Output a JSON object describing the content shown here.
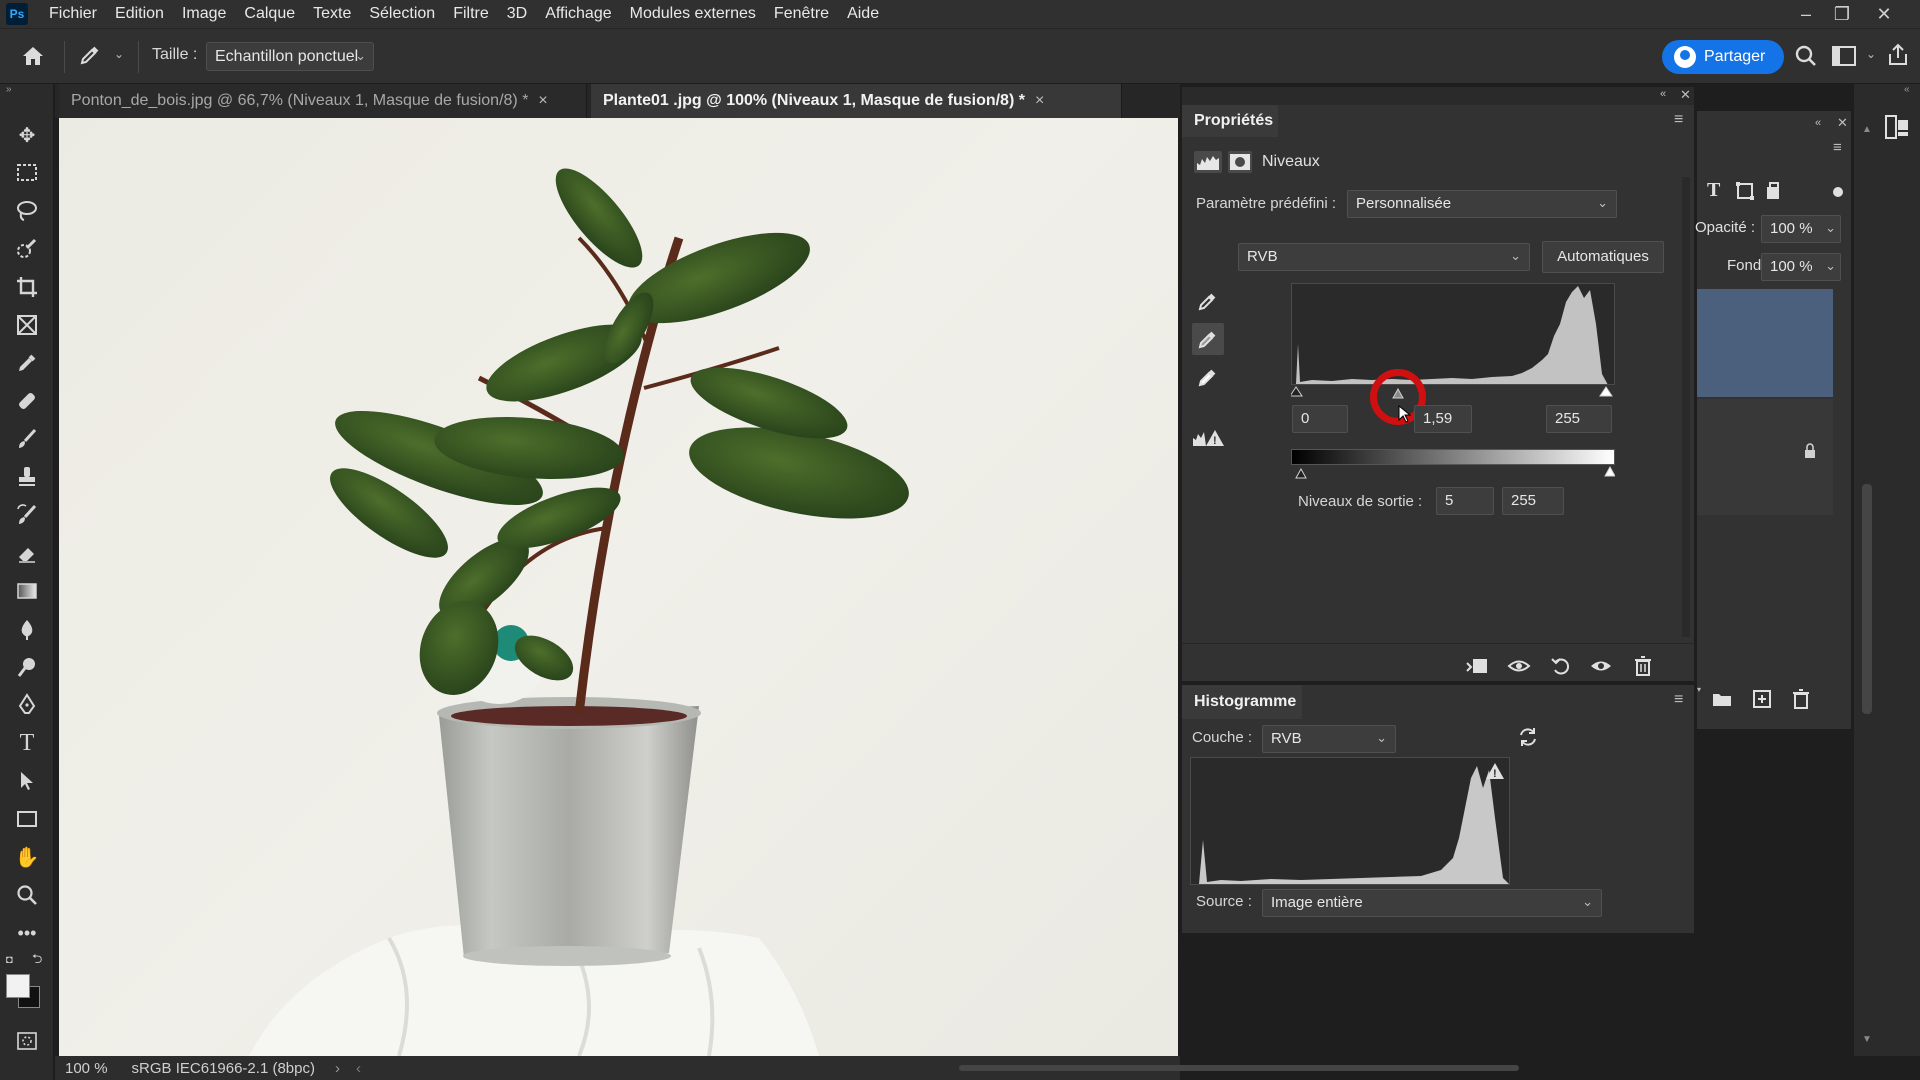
{
  "app": {
    "logo": "Ps",
    "menu": [
      "Fichier",
      "Edition",
      "Image",
      "Calque",
      "Texte",
      "Sélection",
      "Filtre",
      "3D",
      "Affichage",
      "Modules externes",
      "Fenêtre",
      "Aide"
    ]
  },
  "options": {
    "size_label": "Taille :",
    "size_value": "Echantillon ponctuel",
    "share_label": "Partager"
  },
  "tabs": [
    {
      "label": "Ponton_de_bois.jpg @ 66,7% (Niveaux 1, Masque de fusion/8) *",
      "close": "×"
    },
    {
      "label": "Plante01 .jpg @ 100% (Niveaux 1, Masque de fusion/8) *",
      "close": "×"
    }
  ],
  "status": {
    "zoom": "100 %",
    "profile": "sRGB IEC61966-2.1 (8bpc)"
  },
  "properties": {
    "title": "Propriétés",
    "adjustment_name": "Niveaux",
    "preset_label": "Paramètre prédéfini :",
    "preset_value": "Personnalisée",
    "channel_value": "RVB",
    "auto_label": "Automatiques",
    "input_black": "0",
    "input_gamma": "1,59",
    "input_white": "255",
    "output_label": "Niveaux de sortie :",
    "output_black": "5",
    "output_white": "255",
    "gamma_slider_fraction": 0.33,
    "output_black_fraction": 0.02
  },
  "histogram": {
    "title": "Histogramme",
    "channel_label": "Couche :",
    "channel_value": "RVB",
    "source_label": "Source :",
    "source_value": "Image entière"
  },
  "layers_side": {
    "opacity_label": "Opacité :",
    "opacity_value": "100 %",
    "fill_label": "Fond :",
    "fill_value": "100 %"
  },
  "colors": {
    "accent": "#1473e6",
    "cursor_ring": "#d01010",
    "selected_layer": "#4a607d"
  }
}
